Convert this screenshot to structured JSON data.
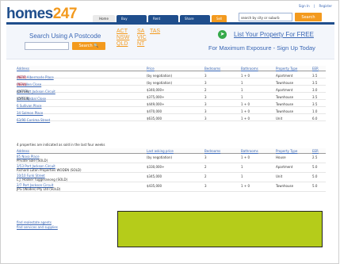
{
  "header": {
    "logo_main": "homes",
    "logo_num": "247",
    "top_links": [
      "Sign In",
      "Register"
    ],
    "nav": [
      "Home",
      "Buy",
      "Rent",
      "Share",
      "Sell"
    ],
    "search_placeholder": "search by city or suburb",
    "search_button": "Search"
  },
  "postcode": {
    "title": "Search Using A Postcode",
    "button": "Search 🔍",
    "states": [
      "ACT",
      "NSW",
      "QLD",
      "SA",
      "VIC",
      "NT",
      "TAS"
    ]
  },
  "promo": {
    "link": "List Your Property For FREE",
    "tagline": "For Maximum Exposure - Sign Up Today"
  },
  "listings": {
    "headers": [
      "Address",
      "Price",
      "Bedrooms",
      "Bathrooms",
      "Property Type",
      "EER"
    ],
    "rows": [
      {
        "address": "46/32 Albermarle Place",
        "tag": "(NEW)",
        "tag_type": "new",
        "price": "(by negotiation)",
        "beds": "3",
        "baths": "1 + 0",
        "type": "Apartment",
        "eer": "3.5"
      },
      {
        "address": "66 Hallen Close",
        "tag": "(NEW)",
        "tag_type": "new",
        "price": "(by negotiation)",
        "beds": "3",
        "baths": "1",
        "type": "Townhouse",
        "eer": "3.5"
      },
      {
        "address": "4/67 Port Jackson Circuit",
        "tag": "(OFFER)",
        "tag_type": "offer",
        "price": "$340,000+",
        "beds": "2",
        "baths": "1",
        "type": "Apartment",
        "eer": "3.0"
      },
      {
        "address": "15/51 Bisbal Close",
        "tag": "(OFFER)",
        "tag_type": "offer",
        "price": "$375,000+",
        "beds": "3",
        "baths": "1",
        "type": "Townhouse",
        "eer": "3.5"
      },
      {
        "address": "6 Sullivan Place",
        "tag": "",
        "tag_type": "",
        "price": "$449,000+",
        "beds": "3",
        "baths": "1 + 0",
        "type": "Townhouse",
        "eer": "3.5"
      },
      {
        "address": "34 Salmon Place",
        "tag": "",
        "tag_type": "",
        "price": "$470,000",
        "beds": "3",
        "baths": "1 + 0",
        "type": "Townhouse",
        "eer": "1.0"
      },
      {
        "address": "63/90 Corrima Street",
        "tag": "",
        "tag_type": "",
        "price": "$635,000",
        "beds": "3",
        "baths": "1 + 0",
        "type": "Unit",
        "eer": "6.0"
      }
    ]
  },
  "sold_note": "4 properties are indicated as sold in the last four weeks",
  "sold": {
    "headers": [
      "Address",
      "Last asking price",
      "Bedrooms",
      "Bathrooms",
      "Property Type",
      "EER"
    ],
    "rows": [
      {
        "address": "85 Nova Place",
        "sub": "Private Sale (SOLD)",
        "price": "(by negotiation)",
        "beds": "3",
        "baths": "1 + 0",
        "type": "House",
        "eer": "2.5"
      },
      {
        "address": "3/53 Port Jackson Circuit",
        "sub": "Richard Luton Properties WODEN (SOLD)",
        "price": "$330,000+",
        "beds": "2",
        "baths": "1",
        "type": "Apartment",
        "eer": "5.0"
      },
      {
        "address": "10/10 Funk Street",
        "sub": "L.J. Hooker Tuggeranong (SOLD)",
        "price": "$345,000",
        "beds": "2",
        "baths": "1",
        "type": "Unit",
        "eer": "5.0"
      },
      {
        "address": "2/7 Port Jackson Circuit",
        "sub": "JPG (Woden) Pty Ltd (SOLD)",
        "price": "$435,000",
        "beds": "3",
        "baths": "1 + 0",
        "type": "Townhouse",
        "eer": "5.0"
      }
    ]
  },
  "footer_links": [
    "find realestate agents",
    "find services and supplies"
  ],
  "colors": {
    "brand_blue": "#1f4e8c",
    "accent_orange": "#f39a1e",
    "link_blue": "#3a67b5",
    "ad_green": "#b5cc1a"
  }
}
